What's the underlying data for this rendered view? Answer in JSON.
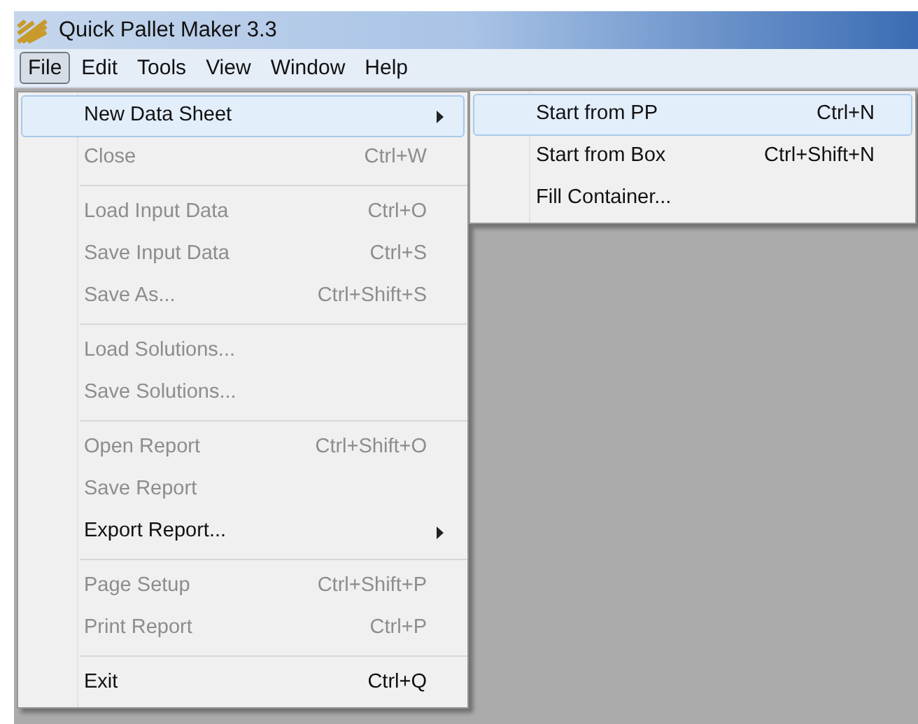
{
  "window": {
    "title": "Quick Pallet Maker 3.3"
  },
  "menu_bar": [
    {
      "label": "File",
      "selected": true
    },
    {
      "label": "Edit",
      "selected": false
    },
    {
      "label": "Tools",
      "selected": false
    },
    {
      "label": "View",
      "selected": false
    },
    {
      "label": "Window",
      "selected": false
    },
    {
      "label": "Help",
      "selected": false
    }
  ],
  "file_menu": [
    {
      "kind": "item",
      "label": "New Data Sheet",
      "disabled": false,
      "submenu": true,
      "selected": true
    },
    {
      "kind": "item",
      "label": "Close",
      "shortcut": "Ctrl+W",
      "disabled": true,
      "submenu": false,
      "selected": false
    },
    {
      "kind": "separator"
    },
    {
      "kind": "item",
      "label": "Load Input Data",
      "shortcut": "Ctrl+O",
      "disabled": true,
      "submenu": false,
      "selected": false
    },
    {
      "kind": "item",
      "label": "Save Input Data",
      "shortcut": "Ctrl+S",
      "disabled": true,
      "submenu": false,
      "selected": false
    },
    {
      "kind": "item",
      "label": "Save As...",
      "shortcut": "Ctrl+Shift+S",
      "disabled": true,
      "submenu": false,
      "selected": false
    },
    {
      "kind": "separator"
    },
    {
      "kind": "item",
      "label": "Load Solutions...",
      "disabled": true,
      "submenu": false,
      "selected": false
    },
    {
      "kind": "item",
      "label": "Save Solutions...",
      "disabled": true,
      "submenu": false,
      "selected": false
    },
    {
      "kind": "separator"
    },
    {
      "kind": "item",
      "label": "Open Report",
      "shortcut": "Ctrl+Shift+O",
      "disabled": true,
      "submenu": false,
      "selected": false
    },
    {
      "kind": "item",
      "label": "Save Report",
      "disabled": true,
      "submenu": false,
      "selected": false
    },
    {
      "kind": "item",
      "label": "Export Report...",
      "disabled": false,
      "submenu": true,
      "selected": false
    },
    {
      "kind": "separator"
    },
    {
      "kind": "item",
      "label": "Page Setup",
      "shortcut": "Ctrl+Shift+P",
      "disabled": true,
      "submenu": false,
      "selected": false
    },
    {
      "kind": "item",
      "label": "Print Report",
      "shortcut": "Ctrl+P",
      "disabled": true,
      "submenu": false,
      "selected": false
    },
    {
      "kind": "separator"
    },
    {
      "kind": "item",
      "label": "Exit",
      "shortcut": "Ctrl+Q",
      "disabled": false,
      "submenu": false,
      "selected": false
    }
  ],
  "submenu": [
    {
      "label": "Start from PP",
      "shortcut": "Ctrl+N",
      "selected": true
    },
    {
      "label": "Start from Box",
      "shortcut": "Ctrl+Shift+N",
      "selected": false
    },
    {
      "label": "Fill Container...",
      "selected": false
    }
  ]
}
